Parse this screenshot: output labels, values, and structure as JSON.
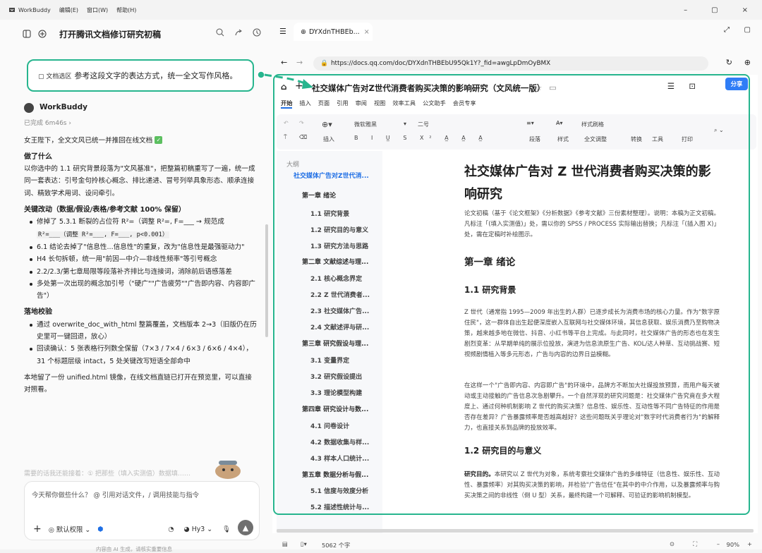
{
  "app": {
    "name": "WorkBuddy",
    "menus": [
      "编辑(E)",
      "窗口(W)",
      "帮助(H)"
    ],
    "window_controls": [
      "–",
      "▢",
      "×"
    ]
  },
  "left": {
    "title": "打开腾讯文档修订研究初稿",
    "selection_tag": "文档选区",
    "selection_text": "参考这段文字的表达方式，统一全文写作风格。",
    "sender": "WorkBuddy",
    "meta": "已完成 6m46s ›",
    "intro": "女王陛下，全文文风已统一并推回在线文档",
    "what_title": "做了什么",
    "what_body": "以你选中的 1.1 研究背景段落为\"文风基准\"，把整篇初稿重写了一遍，统一成同一套表达：引号金句拎核心概念、排比递进、冒号列举具象形态、顺承连接词、精致学术用词、设问牵引。",
    "changes_title": "关键改动（数据/假设/表格/参考文献 100% 保留）",
    "changes": [
      "修掉了 5.3.1 断裂的占位符 R²=（调整 R²=, F=___ → 规范成",
      "6.1 结论去掉了\"信息性...信息性\"的重复，改为\"信息性是最强驱动力\"",
      "H4 长句拆顿，统一用\"前因—中介—非线性频率\"等引号概念",
      "2.2/2.3/第七章局限等段落补齐排比与连接词，消除前后语感落差",
      "多处第一次出现的概念加引号（\"硬广\"\"广告疲劳\"\"广告即内容、内容即广告\"）"
    ],
    "code_line": "R²=___（调整 R²=___, F=___, p<0.001）",
    "verify_title": "落地校验",
    "verify": [
      "通过 overwrite_doc_with_html 整篇覆盖，文档版本 2→3（旧版仍在历史里可一键回退，放心）",
      "回读确认：5 张表格行列数全保留（7×3 / 7×4 / 6×3 / 6×6 / 4×4），31 个标题层级 intact，5 处关键改写短语全部命中"
    ],
    "local_note": "本地留了一份 unified.html 镜像，在线文档直链已打开在预览里，可以直接对照看。",
    "faded": "需要的话我还能接着：① 把那些（填入实测值）数据填……",
    "input_placeholder": "今天帮你做些什么？ @ 引用对话文件，/ 调用技能与指令",
    "perm_label": "默认权限",
    "model_label": "Hy3",
    "footer": "内容由 AI 生成，请核实重要信息"
  },
  "browser": {
    "tab_title": "DYXdnTHBEb...",
    "url": "https://docs.qq.com/doc/DYXdnTHBEbU95Qk1Y?_fid=awgLpDmOyBMX",
    "doc_title": "社交媒体广告对Z世代消费者购买决策的影响研究（文风统一版）",
    "share": "分享",
    "menus": [
      "开始",
      "插入",
      "页面",
      "引用",
      "审阅",
      "视图",
      "效率工具",
      "公文助手",
      "会员专享"
    ],
    "toolbar": {
      "font": "微软雅黑",
      "size": "二号",
      "insert": "插入",
      "para": "段落",
      "style": "样式",
      "style_set": "样式刷格",
      "full": "全文调整",
      "convert": "转换",
      "tools": "工具",
      "print": "打印"
    },
    "outline_title": "大纲",
    "outline": [
      "社交媒体广告对Z世代消...",
      "第一章 绪论",
      "1.1 研究背景",
      "1.2 研究目的与意义",
      "1.3 研究方法与思路",
      "第二章 文献综述与理...",
      "2.1 核心概念界定",
      "2.2 Z 世代消费者...",
      "2.3 社交媒体广告...",
      "2.4 文献述评与研...",
      "第三章 研究假设与理...",
      "3.1 变量界定",
      "3.2 研究假设提出",
      "3.3 理论模型构建",
      "第四章 研究设计与数...",
      "4.1 问卷设计",
      "4.2 数据收集与样...",
      "4.3 样本人口统计...",
      "第五章 数据分析与假...",
      "5.1 信度与效度分析",
      "5.2 描述性统计与..."
    ],
    "page": {
      "title": "社交媒体广告对 Z 世代消费者购买决策的影响研究",
      "note": "论文初稿（基于《论文框架》《分析数据》《参考文献》三份素材整理）。说明：本稿为正文初稿。凡标注「(填入实测值)」处，需以你的 SPSS / PROCESS 实际输出替换；凡标注「(插入图 X)」处，需在定稿时补绘图示。",
      "ch1": "第一章 绪论",
      "s11": "1.1 研究背景",
      "p1": "Z 世代（通常指 1995—2009 年出生的人群）已逐步成长为消费市场的核心力量。作为\"数字原住民\"，这一群体自出生起便深度嵌入互联网与社交媒体环境，其信息获取、娱乐消费乃至购物决策，越来越多地在微信、抖音、小红书等平台上完成。与此同时，社交媒体广告的形态也在发生剧烈变革：从早期单纯的展示位投放，演进为信息流原生广告、KOL/达人种草、互动挑战赛、短视频剧情植入等多元形态，广告与内容的边界日益模糊。",
      "p2": "在这样一个\"广告即内容、内容即广告\"的环境中，品牌方不断加大社媒投放预算，而用户每天被动或主动接触的广告信息次急剧攀升。一个自然浮现的研究问题是：社交媒体广告究竟在多大程度上、通过何种机制影响 Z 世代的购买决策？信息性、娱乐性、互动性等不同广告特征的作用是否存在差异？广告暴露频率是否越高越好？这些问题既关乎理论对\"数字时代消费者行为\"的解释力，也直接关系到品牌的投放效率。",
      "s12": "1.2 研究目的与意义",
      "p3_bold": "研究目的。",
      "p3": "本研究以 Z 世代为对象，系统考察社交媒体广告的多维特征（信息性、娱乐性、互动性、暴露频率）对其购买决策的影响，并检验\"广告信任\"在其中的中介作用，以及暴露频率与购买决策之间的非线性（倒 U 型）关系，最终构建一个可解释、可验证的影响机制模型。"
    },
    "status": {
      "words": "5062 个字",
      "zoom": "90%"
    }
  }
}
